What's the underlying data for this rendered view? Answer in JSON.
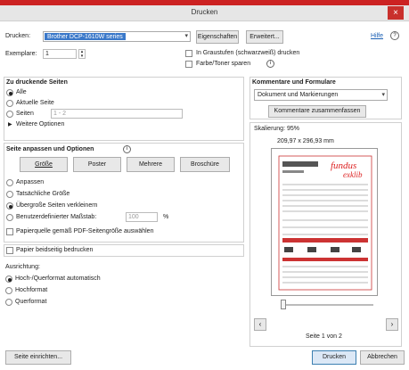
{
  "window": {
    "title": "Drucken",
    "close_glyph": "×"
  },
  "top": {
    "printer_label": "Drucken:",
    "printer_value": "Brother DCP-1610W series",
    "properties_btn": "Eigenschaften",
    "advanced_btn": "Erweitert...",
    "help_link": "Hilfe",
    "copies_label": "Exemplare:",
    "copies_value": "1",
    "grayscale_label": "In Graustufen (schwarzweiß) drucken",
    "save_ink_label": "Farbe/Toner sparen"
  },
  "pages": {
    "heading": "Zu druckende Seiten",
    "all": "Alle",
    "current": "Aktuelle Seite",
    "pages": "Seiten",
    "pages_placeholder": "1 - 2",
    "more": "Weitere Optionen"
  },
  "sizing": {
    "heading": "Seite anpassen und Optionen",
    "tabs": [
      "Größe",
      "Poster",
      "Mehrere",
      "Broschüre"
    ],
    "fit": "Anpassen",
    "actual": "Tatsächliche Größe",
    "shrink": "Übergroße Seiten verkleinern",
    "custom": "Benutzerdefinierter Maßstab:",
    "custom_value": "100",
    "percent": "%",
    "paper_source": "Papierquelle gemäß PDF-Seitengröße auswählen"
  },
  "duplex": {
    "label": "Papier beidseitig bedrucken"
  },
  "orientation": {
    "heading": "Ausrichtung:",
    "auto": "Hoch-/Querformat automatisch",
    "portrait": "Hochformat",
    "landscape": "Querformat"
  },
  "comments": {
    "heading": "Kommentare und Formulare",
    "select_value": "Dokument und Markierungen",
    "summarize_btn": "Kommentare zusammenfassen"
  },
  "preview": {
    "scale_label": "Skalierung: 95%",
    "dims": "209,97 x 296,93 mm",
    "page_status": "Seite 1 von 2",
    "prev_glyph": "‹",
    "next_glyph": "›"
  },
  "bottom": {
    "page_setup_btn": "Seite einrichten...",
    "print_btn": "Drucken",
    "cancel_btn": "Abbrechen"
  },
  "icons": {
    "info": "info-icon",
    "help": "help-icon",
    "triangle": "expand-triangle-icon"
  }
}
